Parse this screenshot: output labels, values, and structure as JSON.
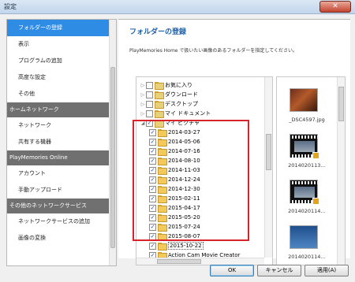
{
  "window": {
    "title": "設定",
    "close_glyph": "✕"
  },
  "sidebar": {
    "items": [
      {
        "label": "フォルダーの登録",
        "type": "item",
        "selected": true
      },
      {
        "label": "表示",
        "type": "item"
      },
      {
        "label": "プログラムの追加",
        "type": "item"
      },
      {
        "label": "高度な設定",
        "type": "item"
      },
      {
        "label": "その他",
        "type": "item"
      },
      {
        "label": "ホームネットワーク",
        "type": "header"
      },
      {
        "label": "ネットワーク",
        "type": "item"
      },
      {
        "label": "共有する機器",
        "type": "item"
      },
      {
        "label": "PlayMemories Online",
        "type": "header"
      },
      {
        "label": "アカウント",
        "type": "item"
      },
      {
        "label": "手動アップロード",
        "type": "item"
      },
      {
        "label": "その他のネットワークサービス",
        "type": "header"
      },
      {
        "label": "ネットワークサービスの追加",
        "type": "item"
      },
      {
        "label": "画像の変換",
        "type": "item"
      }
    ]
  },
  "main": {
    "title": "フォルダーの登録",
    "description": "PlayMemories Home で扱いたい画像のあるフォルダーを指定してください。"
  },
  "tree": {
    "nodes": [
      {
        "label": "お気に入り",
        "level": 1,
        "expander": "▷",
        "checked": false
      },
      {
        "label": "ダウンロード",
        "level": 1,
        "expander": "▷",
        "checked": false
      },
      {
        "label": "デスクトップ",
        "level": 1,
        "expander": "▷",
        "checked": false
      },
      {
        "label": "マイ ドキュメント",
        "level": 1,
        "expander": "▷",
        "checked": false
      },
      {
        "label": "マイ ピクチャ",
        "level": 1,
        "expander": "◢",
        "checked": true
      },
      {
        "label": "2014-03-27",
        "level": 2,
        "checked": true
      },
      {
        "label": "2014-05-06",
        "level": 2,
        "checked": true
      },
      {
        "label": "2014-07-16",
        "level": 2,
        "checked": true
      },
      {
        "label": "2014-08-10",
        "level": 2,
        "checked": true
      },
      {
        "label": "2014-11-03",
        "level": 2,
        "checked": true
      },
      {
        "label": "2014-12-24",
        "level": 2,
        "checked": true
      },
      {
        "label": "2014-12-30",
        "level": 2,
        "checked": true
      },
      {
        "label": "2015-02-11",
        "level": 2,
        "checked": true
      },
      {
        "label": "2015-04-17",
        "level": 2,
        "checked": true
      },
      {
        "label": "2015-05-20",
        "level": 2,
        "checked": true
      },
      {
        "label": "2015-07-24",
        "level": 2,
        "checked": true
      },
      {
        "label": "2015-08-07",
        "level": 2,
        "checked": true
      },
      {
        "label": "2015-10-22",
        "level": 2,
        "checked": true
      },
      {
        "label": "Action Cam Movie Creator",
        "level": 2,
        "checked": true
      }
    ],
    "check_glyph": "✓"
  },
  "thumbnails": {
    "items": [
      {
        "label": "_DSC4597.jpg",
        "kind": "photo"
      },
      {
        "label": "2014020113…",
        "kind": "video"
      },
      {
        "label": "2014020114…",
        "kind": "video"
      },
      {
        "label": "2014020114…",
        "kind": "photo-sky"
      }
    ]
  },
  "buttons": {
    "ok": "OK",
    "cancel": "キャンセル",
    "apply": "適用(A)"
  },
  "colors": {
    "accent": "#2f8ce4",
    "header_bg": "#707070",
    "highlight": "#d6242a",
    "title_blue": "#1c5ea7"
  }
}
